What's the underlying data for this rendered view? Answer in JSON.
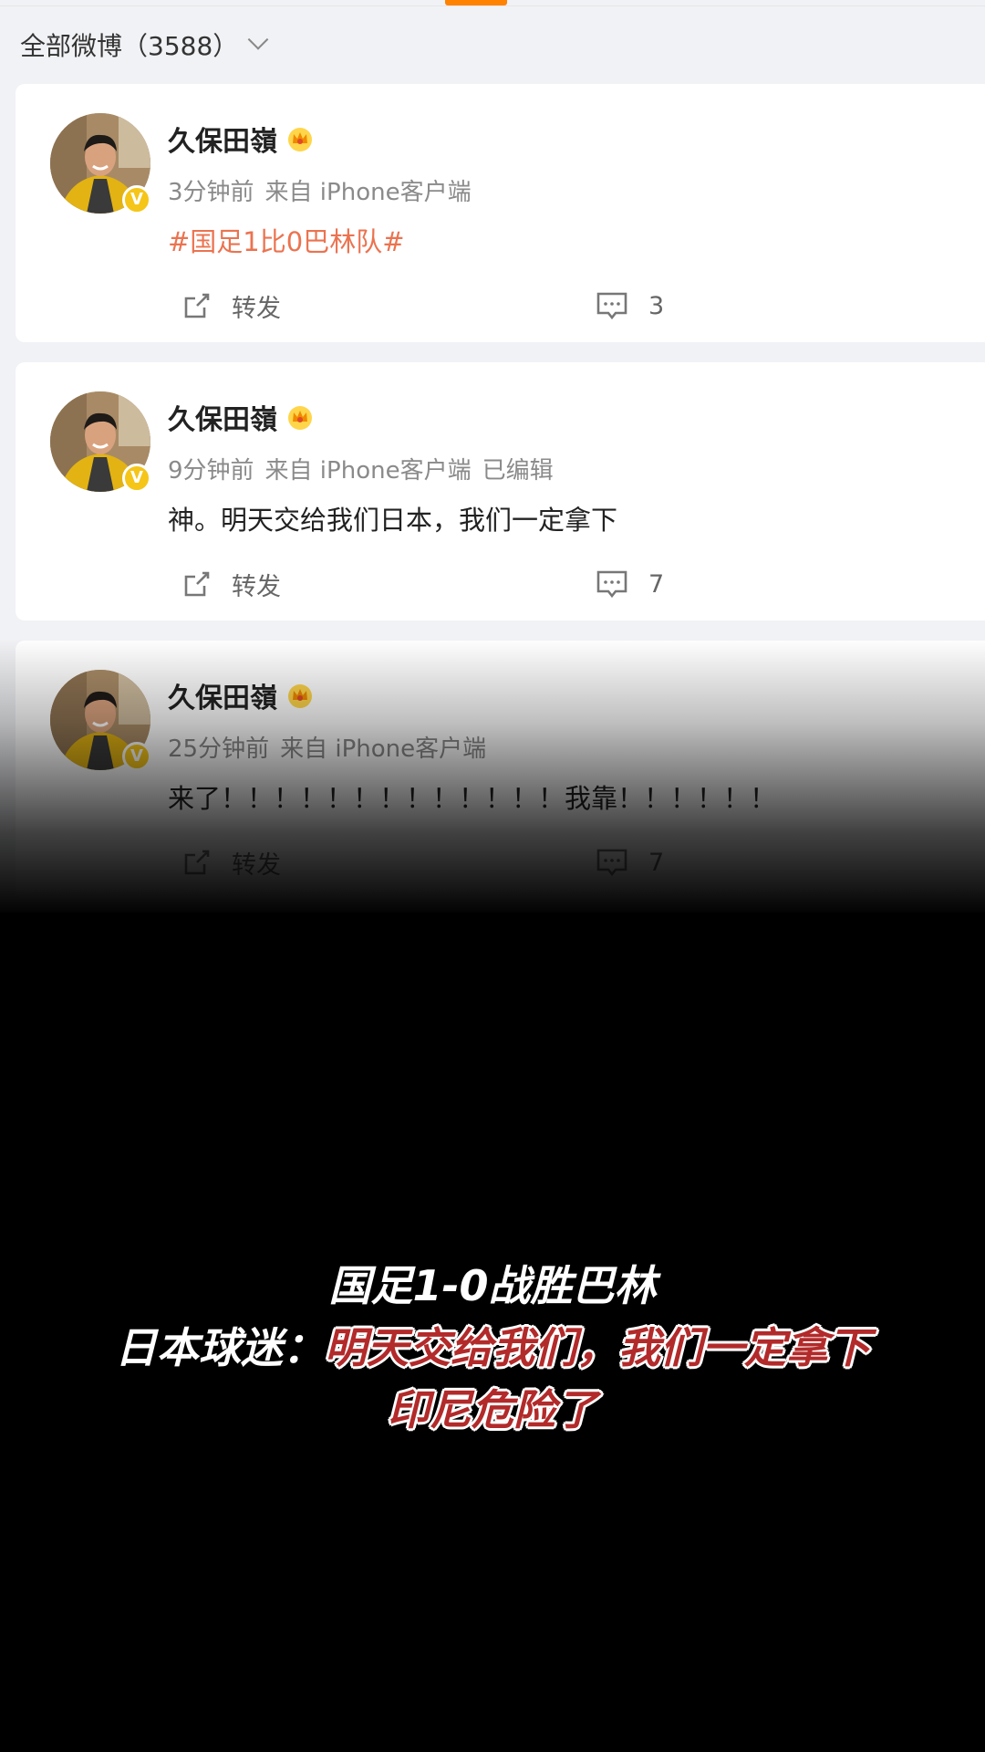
{
  "filter": {
    "label": "全部微博（3588）"
  },
  "posts": [
    {
      "username": "久保田嶺",
      "time": "3分钟前",
      "source": "来自 iPhone客户端",
      "edited": "",
      "text": "#国足1比0巴林队#",
      "is_topic": true,
      "repost_label": "转发",
      "comments": "3"
    },
    {
      "username": "久保田嶺",
      "time": "9分钟前",
      "source": "来自 iPhone客户端",
      "edited": "已编辑",
      "text": "神。明天交给我们日本，我们一定拿下",
      "is_topic": false,
      "repost_label": "转发",
      "comments": "7"
    },
    {
      "username": "久保田嶺",
      "time": "25分钟前",
      "source": "来自 iPhone客户端",
      "edited": "",
      "text": "来了！！！！！！！！！！！！！我靠！！！！！！",
      "is_topic": false,
      "repost_label": "转发",
      "comments": "7"
    }
  ],
  "caption": {
    "line1": "国足1-0战胜巴林",
    "line2_prefix": "日本球迷：",
    "line2_highlight": "明天交给我们，我们一定拿下",
    "line3": "印尼危险了"
  },
  "colors": {
    "accent": "#ff8200",
    "topic": "#eb7350",
    "verified": "#f5c518",
    "caption_red": "#b22a2a"
  },
  "icons": [
    "chevron-down-icon",
    "verified-badge-icon",
    "crown-icon",
    "repost-icon",
    "comment-icon"
  ]
}
